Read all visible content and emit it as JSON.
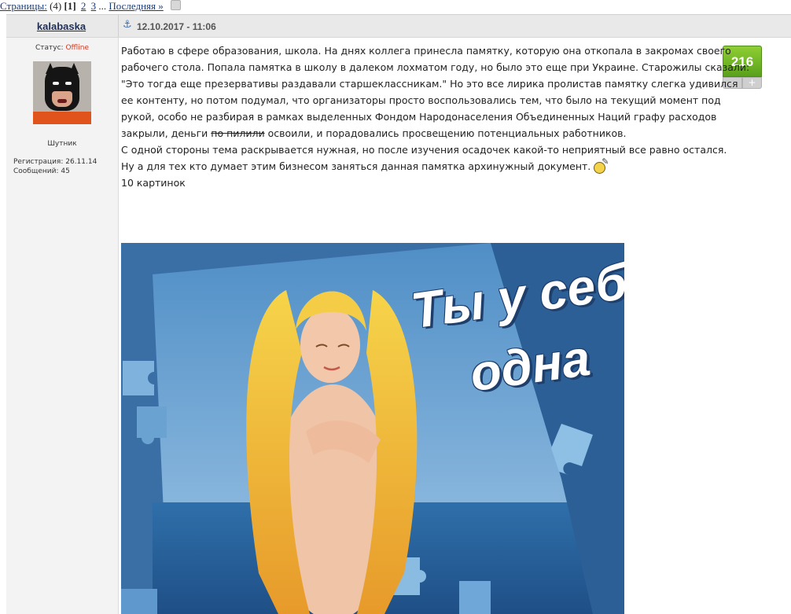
{
  "pagination": {
    "label": "Страницы:",
    "total": "(4)",
    "current": "[1]",
    "pages": [
      "2",
      "3"
    ],
    "ellipsis": "...",
    "last": "Последняя »"
  },
  "post": {
    "author": "kalabaska",
    "date": "12.10.2017 - 11:06",
    "status_label": "Статус:",
    "status_value": "Offline",
    "user_title": "Шутник",
    "registration": "Регистрация: 26.11.14",
    "messages": "Сообщений: 45",
    "rating": "216",
    "rating_minus": "−",
    "rating_plus": "+",
    "body": {
      "p1_part1": "Работаю в сфере образования, школа. На днях коллега принесла памятку, которую она откопала в закромах своего рабочего стола. Попала памятка в школу в далеком лохматом году, но было это еще при Украине. Старожилы сказали: \"Это тогда еще презервативы раздавали старшеклассникам.\" Но это все лирика пролистав памятку слегка удивился ее контенту, но потом подумал, что организаторы просто воспользовались тем, что было на текущий момент под рукой, особо не разбирая в рамках выделенных Фондом Народонаселения Объединенных Наций графу расходов закрыли, деньги",
      "strike": "по пилили",
      "p1_part2": "освоили, и порадовались просвещению потенциальных работников.",
      "p2": "С одной стороны тема раскрывается нужная, но после изучения осадочек какой-то неприятный все равно остался.",
      "p3": "Ну а для тех кто думает этим бизнесом заняться данная памятка архинужный документ.",
      "pics_count": "10 картинок"
    },
    "image": {
      "line1": "Ты у себя",
      "line2": "одна"
    }
  },
  "colors": {
    "header_bg": "#e9e9e9",
    "offline": "#cc3a24",
    "rating_green": "#6cb325",
    "link": "#1a3b78"
  }
}
